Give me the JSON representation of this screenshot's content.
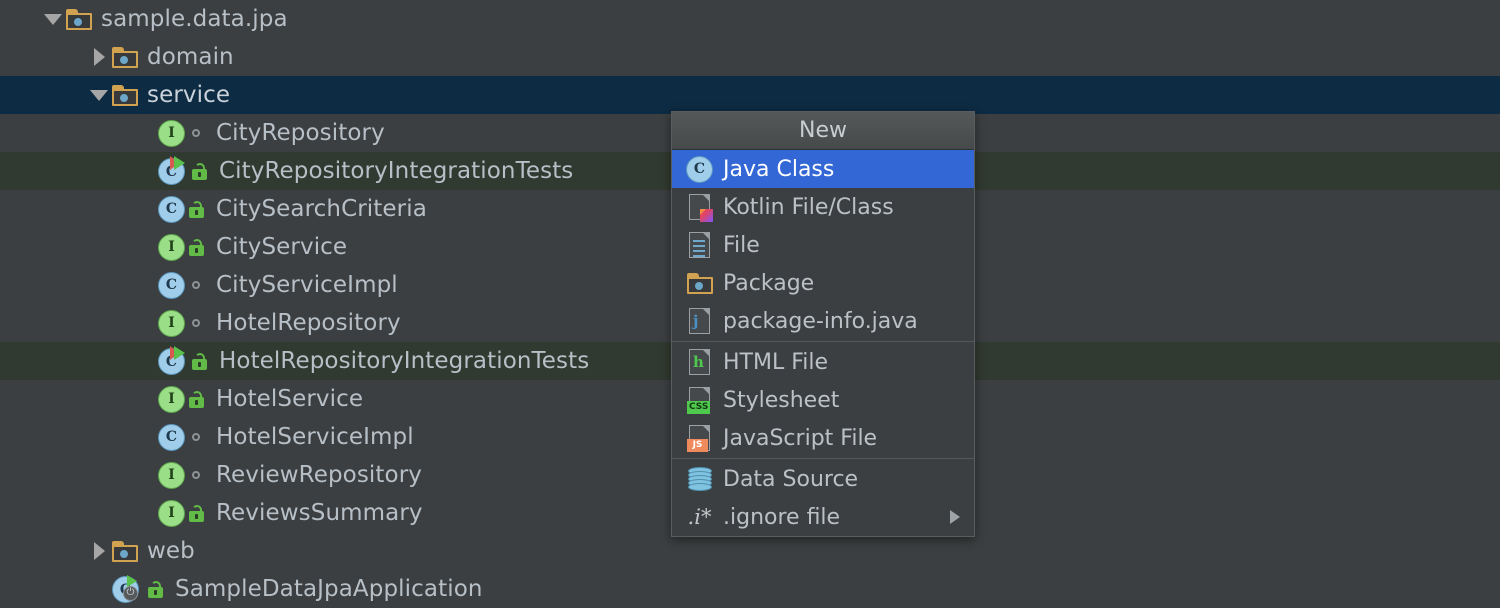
{
  "theme": {
    "background": "#3c3f41",
    "row_selected": "#0d2b42",
    "row_test": "#303a30",
    "menu_background": "#3c3f41",
    "menu_highlight": "#3367d6",
    "text": "#b7bfc7"
  },
  "tree": {
    "items": [
      {
        "label": "sample.data.jpa",
        "icon": "package-folder-icon",
        "twisty": "expanded",
        "indent": 0,
        "state": "normal",
        "badge": "none"
      },
      {
        "label": "domain",
        "icon": "package-folder-icon",
        "twisty": "collapsed",
        "indent": 1,
        "state": "normal",
        "badge": "none"
      },
      {
        "label": "service",
        "icon": "package-folder-icon",
        "twisty": "expanded",
        "indent": 1,
        "state": "selected",
        "badge": "none"
      },
      {
        "label": "CityRepository",
        "icon": "interface-icon",
        "twisty": "none",
        "indent": 2,
        "state": "normal",
        "badge": "package-private-dot"
      },
      {
        "label": "CityRepositoryIntegrationTests",
        "icon": "runnable-class-icon",
        "twisty": "none",
        "indent": 2,
        "state": "test",
        "badge": "public-lock"
      },
      {
        "label": "CitySearchCriteria",
        "icon": "class-icon",
        "twisty": "none",
        "indent": 2,
        "state": "normal",
        "badge": "public-lock"
      },
      {
        "label": "CityService",
        "icon": "interface-icon",
        "twisty": "none",
        "indent": 2,
        "state": "normal",
        "badge": "public-lock"
      },
      {
        "label": "CityServiceImpl",
        "icon": "class-icon",
        "twisty": "none",
        "indent": 2,
        "state": "normal",
        "badge": "package-private-dot"
      },
      {
        "label": "HotelRepository",
        "icon": "interface-icon",
        "twisty": "none",
        "indent": 2,
        "state": "normal",
        "badge": "package-private-dot"
      },
      {
        "label": "HotelRepositoryIntegrationTests",
        "icon": "runnable-class-icon",
        "twisty": "none",
        "indent": 2,
        "state": "test",
        "badge": "public-lock"
      },
      {
        "label": "HotelService",
        "icon": "interface-icon",
        "twisty": "none",
        "indent": 2,
        "state": "normal",
        "badge": "public-lock"
      },
      {
        "label": "HotelServiceImpl",
        "icon": "class-icon",
        "twisty": "none",
        "indent": 2,
        "state": "normal",
        "badge": "package-private-dot"
      },
      {
        "label": "ReviewRepository",
        "icon": "interface-icon",
        "twisty": "none",
        "indent": 2,
        "state": "normal",
        "badge": "package-private-dot"
      },
      {
        "label": "ReviewsSummary",
        "icon": "interface-icon",
        "twisty": "none",
        "indent": 2,
        "state": "normal",
        "badge": "public-lock"
      },
      {
        "label": "web",
        "icon": "package-folder-icon",
        "twisty": "collapsed",
        "indent": 1,
        "state": "normal",
        "badge": "none"
      },
      {
        "label": "SampleDataJpaApplication",
        "icon": "spring-boot-application-icon",
        "twisty": "none",
        "indent": 1,
        "state": "normal",
        "badge": "public-lock"
      }
    ]
  },
  "context_menu": {
    "title": "New",
    "groups": [
      {
        "items": [
          {
            "label": "Java Class",
            "icon": "java-class-icon",
            "highlighted": true,
            "submenu": false
          },
          {
            "label": "Kotlin File/Class",
            "icon": "kotlin-file-icon",
            "highlighted": false,
            "submenu": false
          },
          {
            "label": "File",
            "icon": "file-icon",
            "highlighted": false,
            "submenu": false
          },
          {
            "label": "Package",
            "icon": "package-folder-icon",
            "highlighted": false,
            "submenu": false
          },
          {
            "label": "package-info.java",
            "icon": "java-file-icon",
            "highlighted": false,
            "submenu": false
          }
        ]
      },
      {
        "items": [
          {
            "label": "HTML File",
            "icon": "html-file-icon",
            "highlighted": false,
            "submenu": false
          },
          {
            "label": "Stylesheet",
            "icon": "css-file-icon",
            "highlighted": false,
            "submenu": false
          },
          {
            "label": "JavaScript File",
            "icon": "javascript-file-icon",
            "highlighted": false,
            "submenu": false
          }
        ]
      },
      {
        "items": [
          {
            "label": "Data Source",
            "icon": "data-source-icon",
            "highlighted": false,
            "submenu": false
          },
          {
            "label": ".ignore file",
            "icon": "ignore-file-icon",
            "highlighted": false,
            "submenu": true
          }
        ]
      }
    ]
  }
}
